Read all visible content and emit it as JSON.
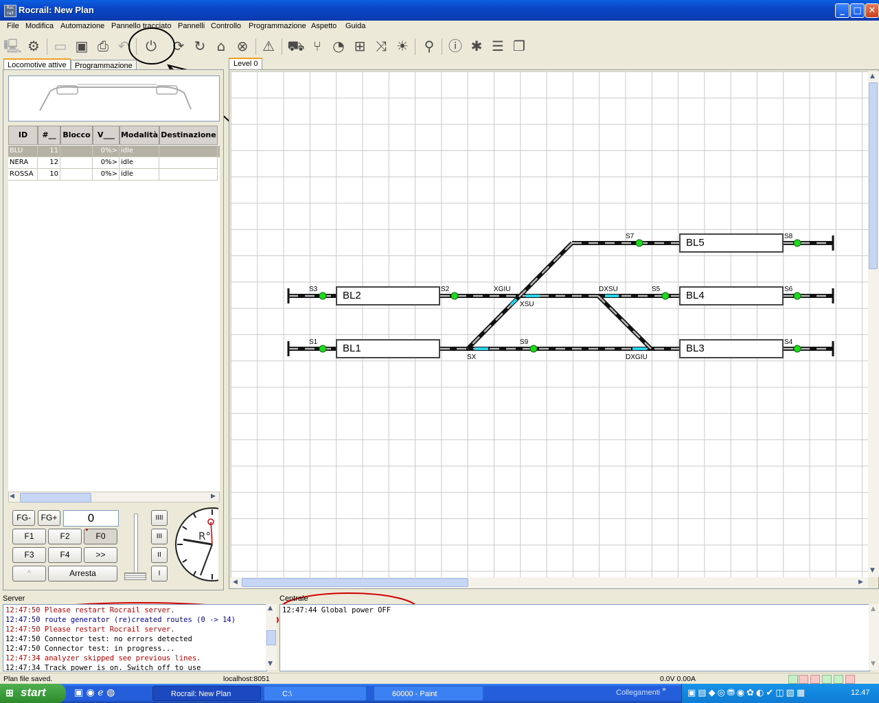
{
  "window": {
    "title": "Rocrail: New Plan",
    "app_icon": "Roc rail"
  },
  "menu": [
    "File",
    "Modifica",
    "Automazione",
    "Pannello tracciato",
    "Pannelli",
    "Controllo",
    "Programmazione",
    "Aspetto",
    "Guida"
  ],
  "toolbar_icons": [
    "server-icon",
    "settings-gear-icon",
    "open-folder-icon",
    "save-icon",
    "print-icon",
    "undo-icon",
    "power-icon",
    "cycle-icon",
    "refresh-icon",
    "home-icon",
    "stop-circle-icon",
    "warning-icon",
    "locomotive-icon",
    "turnout-icon",
    "speedometer-icon",
    "network-icon",
    "shuffle-icon",
    "light-icon",
    "zoom-icon",
    "info-icon",
    "bug-icon",
    "list-icon",
    "pages-icon"
  ],
  "left_tabs": {
    "active": "Locomotive attive",
    "programming": "Programmazione"
  },
  "loco_table": {
    "headers": [
      "ID",
      "#__",
      "Blocco",
      "V___",
      "Modalità",
      "Destinazione"
    ],
    "rows": [
      {
        "id": "BLU",
        "addr": "11",
        "block": "",
        "v": "0%>",
        "mode": "idle",
        "dest": ""
      },
      {
        "id": "NERA",
        "addr": "12",
        "block": "",
        "v": "0%>",
        "mode": "idle",
        "dest": ""
      },
      {
        "id": "ROSSA",
        "addr": "10",
        "block": "",
        "v": "0%>",
        "mode": "idle",
        "dest": ""
      }
    ]
  },
  "throttle": {
    "fg_minus": "FG-",
    "fg_plus": "FG+",
    "speed": "0",
    "f1": "F1",
    "f2": "F2",
    "f0": "F0",
    "f3": "F3",
    "f4": "F4",
    "more": ">>",
    "up": "^",
    "stop": "Arresta",
    "step4": "IIII",
    "step3": "III",
    "step2": "II",
    "step1": "I",
    "clock_text": "R°"
  },
  "plan": {
    "level_tab": "Level 0",
    "blocks": [
      "BL1",
      "BL2",
      "BL3",
      "BL4",
      "BL5"
    ],
    "labels": [
      "S1",
      "S2",
      "S3",
      "S4",
      "S5",
      "S6",
      "S7",
      "S8",
      "S9",
      "XGIU",
      "XSU",
      "DXSU",
      "DXGIU",
      "SX"
    ]
  },
  "logs": {
    "server_label": "Server",
    "central_label": "Centrale",
    "server_lines": [
      {
        "text": "12:47:50 Please restart Rocrail server.",
        "color": "#c00000"
      },
      {
        "text": "12:47:50 route generator (re)created routes (0 -> 14)",
        "color": "#0000a0"
      },
      {
        "text": "12:47:50 Please restart Rocrail server.",
        "color": "#c00000"
      },
      {
        "text": "12:47:50 Connector test: no errors detected",
        "color": "#000000"
      },
      {
        "text": "12:47:50 Connector test: in progress...",
        "color": "#000000"
      },
      {
        "text": "12:47:34 analyzer skipped see previous lines.",
        "color": "#c00000"
      },
      {
        "text": "12:47:34 Track power is on. Switch off to use",
        "color": "#000000"
      }
    ],
    "central_lines": [
      "12:47:44 Global power OFF"
    ]
  },
  "status": {
    "message": "Plan file saved.",
    "host": "localhost:8051",
    "power": "0.0V 0.00A"
  },
  "taskbar": {
    "start": "start",
    "tasks": [
      "Rocrail: New Plan",
      "C:\\",
      "60000 - Paint"
    ],
    "links_label": "Collegamenti",
    "clock": "12.47"
  }
}
